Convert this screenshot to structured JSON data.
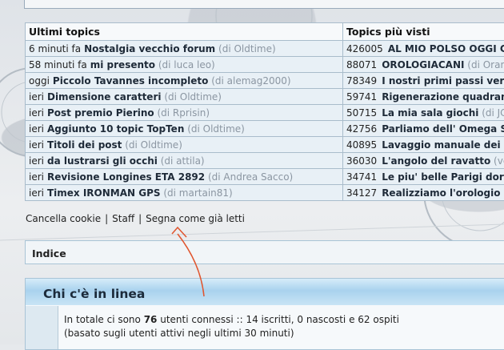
{
  "topics": {
    "header_latest": "Ultimi topics",
    "header_most_viewed": "Topics più visti",
    "latest": [
      {
        "time": "6 minuti fa",
        "title": "Nostalgia vecchio forum",
        "author": "(di Oldtime)"
      },
      {
        "time": "58 minuti fa",
        "title": "mi presento",
        "author": "(di luca leo)"
      },
      {
        "time": "oggi",
        "title": "Piccolo Tavannes incompleto",
        "author": "(di alemag2000)"
      },
      {
        "time": "ieri",
        "title": "Dimensione caratteri",
        "author": "(di Oldtime)"
      },
      {
        "time": "ieri",
        "title": "Post premio Pierino",
        "author": "(di Rprisin)"
      },
      {
        "time": "ieri",
        "title": "Aggiunto 10 topic TopTen",
        "author": "(di Oldtime)"
      },
      {
        "time": "ieri",
        "title": "Titoli dei post",
        "author": "(di Oldtime)"
      },
      {
        "time": "ieri",
        "title": "da lustrarsi gli occhi",
        "author": "(di attila)"
      },
      {
        "time": "ieri",
        "title": "Revisione Longines ETA 2892",
        "author": "(di Andrea Sacco)"
      },
      {
        "time": "ieri",
        "title": "Timex IRONMAN GPS",
        "author": "(di martain81)"
      }
    ],
    "most_viewed": [
      {
        "views": "426005",
        "title": "AL MIO POLSO OGGI C'E'"
      },
      {
        "views": "88071",
        "title": "OROLOGIACANI",
        "author": "(di Orantis)"
      },
      {
        "views": "78349",
        "title": "I nostri primi passi verso"
      },
      {
        "views": "59741",
        "title": "Rigenerazione quadranti"
      },
      {
        "views": "50715",
        "title": "La mia sala giochi",
        "author": "(di JCH)"
      },
      {
        "views": "42756",
        "title": "Parliamo dell' Omega Spe"
      },
      {
        "views": "40895",
        "title": "Lavaggio manuale dei mo"
      },
      {
        "views": "36030",
        "title": "L'angolo del ravatto",
        "author": "(ver"
      },
      {
        "views": "34741",
        "title": "Le piu' belle Parigi dorate"
      },
      {
        "views": "34127",
        "title": "Realizziamo l'orologio di"
      }
    ]
  },
  "links": {
    "cookies": "Cancella cookie",
    "staff": "Staff",
    "mark_read": "Segna come già letti",
    "sep": "|"
  },
  "index": {
    "label": "Indice"
  },
  "online": {
    "title": "Chi c'è in linea",
    "prefix": "In totale ci sono ",
    "count": "76",
    "suffix": " utenti connessi :: 14 iscritti, 0 nascosti e 62 ospiti",
    "note": "(basato sugli utenti attivi negli ultimi 30 minuti)"
  },
  "colors": {
    "annotation_arrow": "#e0552e",
    "header_gradient": "#a9d2ee"
  }
}
